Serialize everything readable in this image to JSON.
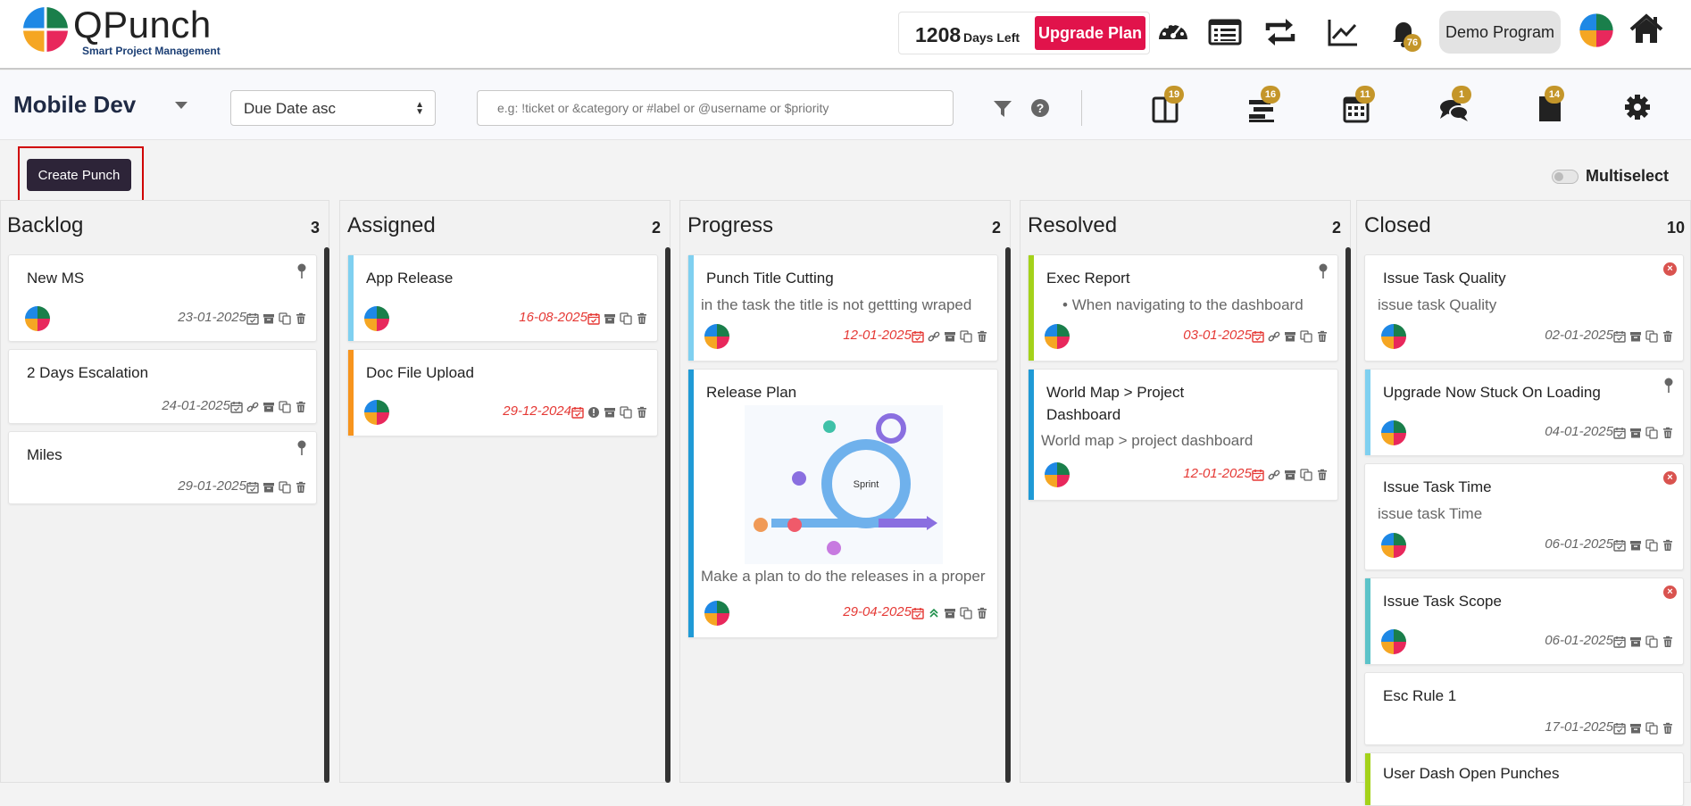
{
  "header": {
    "brand_name": "QPunch",
    "tagline": "Smart Project Management",
    "days_left_number": "1208",
    "days_left_label": "Days Left",
    "upgrade_label": "Upgrade Plan",
    "notification_count": "76",
    "program_label": "Demo Program",
    "icons": [
      "dashboard-gauge-icon",
      "list-icon",
      "sync-icon",
      "chart-line-icon",
      "bell-icon",
      "avatar",
      "home-icon"
    ]
  },
  "toolbar": {
    "project_name": "Mobile Dev",
    "sort_value": "Due Date asc",
    "search_placeholder": "e.g: !ticket or &category or #label or @username or $priority",
    "view_badges": [
      "19",
      "16",
      "11",
      "1",
      "14"
    ]
  },
  "actions": {
    "create_label": "Create Punch",
    "multiselect_label": "Multiselect"
  },
  "columns": [
    {
      "title": "Backlog",
      "count": "3",
      "cards": [
        {
          "title": "New MS",
          "date": "23-01-2025"
        },
        {
          "title": "2 Days Escalation",
          "date": "24-01-2025"
        },
        {
          "title": "Miles",
          "date": "29-01-2025"
        }
      ]
    },
    {
      "title": "Assigned",
      "count": "2",
      "cards": [
        {
          "title": "App Release",
          "date": "16-08-2025"
        },
        {
          "title": "Doc File Upload",
          "date": "29-12-2024"
        }
      ]
    },
    {
      "title": "Progress",
      "count": "2",
      "cards": [
        {
          "title": "Punch Title Cutting",
          "desc": "in the task the title is not gettting wraped",
          "date": "12-01-2025"
        },
        {
          "title": "Release Plan",
          "desc": "Make a plan to do the releases in a proper",
          "date": "29-04-2025",
          "image_text": "Sprint"
        }
      ]
    },
    {
      "title": "Resolved",
      "count": "2",
      "cards": [
        {
          "title": "Exec Report",
          "desc": "When navigating to the dashboard",
          "date": "03-01-2025"
        },
        {
          "title": "World Map > Project Dashboard",
          "desc": "World map > project dashboard",
          "date": "12-01-2025"
        }
      ]
    },
    {
      "title": "Closed",
      "count": "10",
      "cards": [
        {
          "title": "Issue Task Quality",
          "desc": "issue task Quality",
          "date": "02-01-2025"
        },
        {
          "title": "Upgrade Now Stuck On Loading",
          "date": "04-01-2025"
        },
        {
          "title": "Issue Task Time",
          "desc": "issue task Time",
          "date": "06-01-2025"
        },
        {
          "title": "Issue Task Scope",
          "date": "06-01-2025"
        },
        {
          "title": "Esc Rule 1",
          "date": "17-01-2025"
        },
        {
          "title": "User Dash Open Punches"
        }
      ]
    }
  ],
  "colors": {
    "upgrade": "#e1134b",
    "badge": "#c4962a",
    "create_button": "#2d2438",
    "overdue_date": "#e53935",
    "bar_blue_light": "#7fd0f0",
    "bar_orange": "#f7941d",
    "bar_blue": "#1f9ad6",
    "bar_green": "#a4d21a",
    "bar_teal": "#5cc3c9"
  }
}
